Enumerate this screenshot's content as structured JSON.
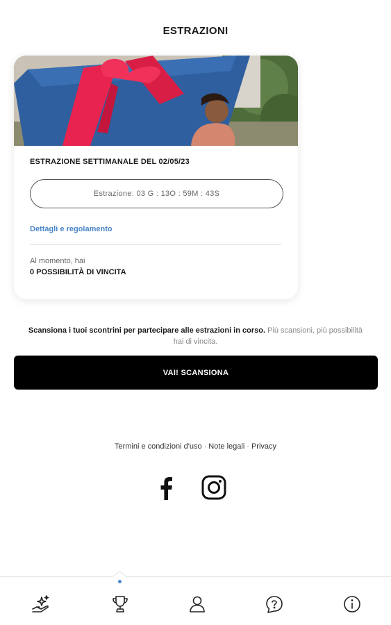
{
  "header": {
    "title": "ESTRAZIONI"
  },
  "draw_card": {
    "image": "gift-illustration",
    "title": "ESTRAZIONE SETTIMANALE DEL 02/05/23",
    "countdown": "Estrazione: 03 G : 13O : 59M : 43S",
    "details_link": "Dettagli e regolamento",
    "chances_label": "Al momento, hai",
    "chances_value": "0 POSSIBILITÀ DI VINCITA"
  },
  "scan_info": {
    "bold": "Scansiona i tuoi scontrini per partecipare alle estrazioni in corso.",
    "rest": " Più scansioni, più possibilità hai di vincita."
  },
  "scan_button": {
    "label": "VAI! SCANSIONA"
  },
  "footer": {
    "links": [
      "Termini e condizioni d'uso",
      "Note legali",
      "Privacy"
    ],
    "separator": "·"
  },
  "social": {
    "icons": [
      "facebook-icon",
      "instagram-icon"
    ]
  },
  "tabbar": {
    "items": [
      "rewards-icon",
      "trophy-icon",
      "profile-icon",
      "help-icon",
      "info-icon"
    ],
    "active_index": 1,
    "accent": "#4a86c8"
  },
  "colors": {
    "button_bg": "#000000",
    "link": "#4a86c8",
    "ribbon": "#e8234f",
    "gift_box": "#2f5f9e"
  }
}
